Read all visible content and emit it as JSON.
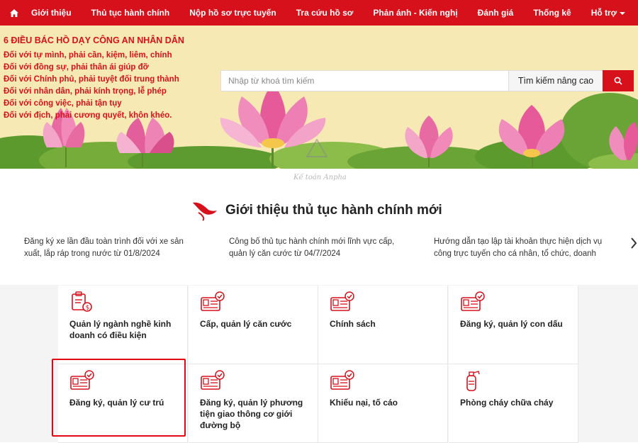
{
  "nav": {
    "items": [
      "Giới thiệu",
      "Thủ tục hành chính",
      "Nộp hồ sơ trực tuyến",
      "Tra cứu hồ sơ",
      "Phản ánh - Kiến nghị",
      "Đánh giá",
      "Thống kê"
    ],
    "support": "Hỗ trợ"
  },
  "banner": {
    "title": "6 ĐIỀU BÁC HỒ DẠY CÔNG AN NHÂN DÂN",
    "lines": [
      "Đối với tự mình, phải cần, kiệm, liêm, chính",
      "Đối với đồng sự, phải thân ái giúp đỡ",
      "Đối với Chính phủ, phải tuyệt đối trung thành",
      "Đối với nhân dân, phải kính trọng, lễ phép",
      "Đối với công việc, phải tận tụy",
      "Đối với địch, phải cương quyết, khôn khéo."
    ]
  },
  "search": {
    "placeholder": "Nhập từ khoá tìm kiếm",
    "advanced": "Tìm kiếm nâng cao"
  },
  "watermark": "Kế toán Anpha",
  "intro": {
    "title": "Giới thiệu thủ tục hành chính mới",
    "news": [
      "Đăng ký xe lần đầu toàn trình đối với xe sản xuất, lắp ráp trong nước từ 01/8/2024",
      "Công bố thủ tục hành chính mới lĩnh vực cấp, quản lý căn cước từ 04/7/2024",
      "Hướng dẫn tạo lập tài khoản thực hiện dịch vụ công trực tuyến cho cá nhân, tổ chức, doanh"
    ]
  },
  "categories": [
    {
      "label": "Quản lý ngành nghề kinh doanh có điều kiện",
      "icon": "business-license-icon"
    },
    {
      "label": "Cấp, quản lý căn cước",
      "icon": "id-card-icon"
    },
    {
      "label": "Chính sách",
      "icon": "id-card-icon"
    },
    {
      "label": "Đăng ký, quản lý con dấu",
      "icon": "id-card-icon"
    },
    {
      "label": "Đăng ký, quản lý cư trú",
      "icon": "id-card-icon"
    },
    {
      "label": "Đăng ký, quản lý phương tiện giao thông cơ giới đường bộ",
      "icon": "id-card-icon"
    },
    {
      "label": "Khiếu nại, tố cáo",
      "icon": "id-card-icon"
    },
    {
      "label": "Phòng cháy chữa cháy",
      "icon": "fire-extinguisher-icon"
    }
  ],
  "colors": {
    "primary": "#d7111c",
    "banner": "#f7e9b4",
    "highlight": "#e30613"
  }
}
